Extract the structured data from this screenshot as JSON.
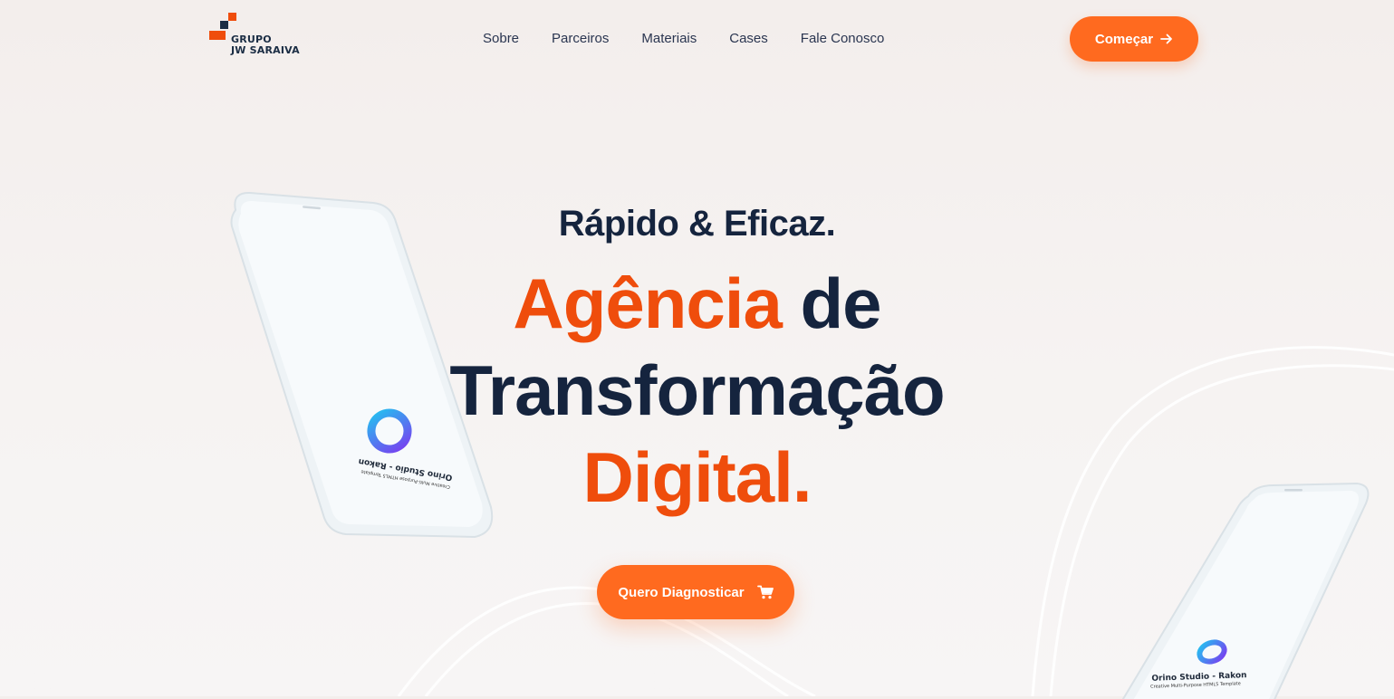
{
  "brand": {
    "line1": "GRUPO",
    "line2": "JW SARAIVA",
    "colors": {
      "navy": "#1b2d44",
      "orange": "#ef4d0c"
    }
  },
  "nav": {
    "items": [
      {
        "label": "Sobre"
      },
      {
        "label": "Parceiros"
      },
      {
        "label": "Materiais"
      },
      {
        "label": "Cases"
      },
      {
        "label": "Fale Conosco"
      }
    ]
  },
  "header_cta": {
    "label": "Começar",
    "icon": "arrow-right-icon"
  },
  "hero": {
    "eyebrow": "Rápido & Eficaz.",
    "headline": {
      "line1_accent": "Agência",
      "line1_rest": " de",
      "line2": "Transformação",
      "line3": "Digital."
    },
    "cta": {
      "label": "Quero Diagnosticar",
      "icon": "cart-icon"
    }
  },
  "phone_screens": {
    "left": {
      "title": "Orino Studio - Rakon",
      "subtitle": "Creative Multi-Purpose HTML5 Template"
    },
    "right": {
      "title": "Orino Studio - Rakon",
      "subtitle": "Creative Multi-Purpose HTML5 Template"
    }
  },
  "theme": {
    "accent": "#ff6a1f",
    "headline_accent": "#ef4d0c",
    "text_dark": "#15243e",
    "background": "#f3eeec"
  }
}
